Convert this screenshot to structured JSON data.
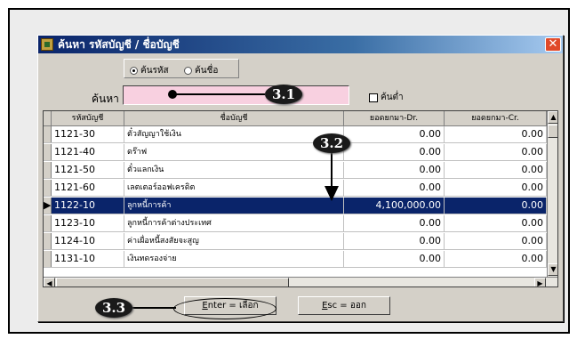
{
  "window": {
    "title": "ค้นหา รหัสบัญชี / ชื่อบัญชี",
    "close_glyph": "✕"
  },
  "search_mode": {
    "options": [
      "ค้นรหัส",
      "ค้นชื่อ"
    ],
    "selected": "ค้นรหัส"
  },
  "search": {
    "label": "ค้นหา",
    "value": "",
    "checkbox_label": "ค้นต่ำ",
    "checked": false
  },
  "table": {
    "columns": [
      "รหัสบัญชี",
      "ชื่อบัญชี",
      "ยอดยกมา-Dr.",
      "ยอดยกมา-Cr."
    ],
    "rows": [
      {
        "code": "1121-30",
        "name": "ตั๋วสัญญาใช้เงิน",
        "dr": "0.00",
        "cr": "0.00"
      },
      {
        "code": "1121-40",
        "name": "ดร๊าฟ",
        "dr": "0.00",
        "cr": "0.00"
      },
      {
        "code": "1121-50",
        "name": "ตั๋วแลกเงิน",
        "dr": "0.00",
        "cr": "0.00"
      },
      {
        "code": "1121-60",
        "name": "เลตเตอร์ออฟเครดิต",
        "dr": "0.00",
        "cr": "0.00"
      },
      {
        "code": "1122-10",
        "name": "ลูกหนี้การค้า",
        "dr": "4,100,000.00",
        "cr": "0.00"
      },
      {
        "code": "1123-10",
        "name": "ลูกหนี้การค้าต่างประเทศ",
        "dr": "0.00",
        "cr": "0.00"
      },
      {
        "code": "1124-10",
        "name": "ค่าเผื่อหนี้สงสัยจะสูญ",
        "dr": "0.00",
        "cr": "0.00"
      },
      {
        "code": "1131-10",
        "name": "เงินทดรองจ่าย",
        "dr": "0.00",
        "cr": "0.00"
      }
    ],
    "selected_index": 4
  },
  "buttons": {
    "enter_key": "E",
    "enter_label": "nter = เลือก",
    "esc_key": "E",
    "esc_label": "sc = ออก"
  },
  "callouts": {
    "c31": "3.1",
    "c32": "3.2",
    "c33": "3.3"
  },
  "icons": {
    "app": "app-icon",
    "close": "close-icon",
    "scroll_up": "▲",
    "scroll_down": "▼",
    "scroll_left": "◀",
    "scroll_right": "▶",
    "row_pointer": "▶"
  }
}
